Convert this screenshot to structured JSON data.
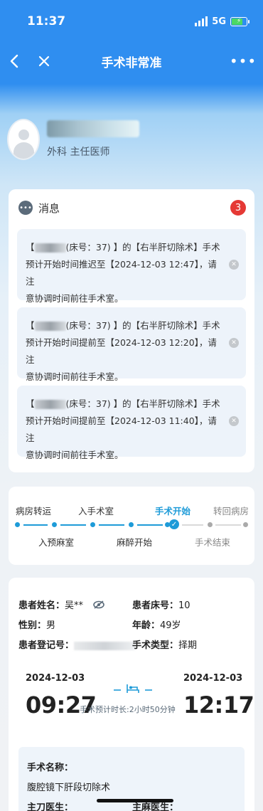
{
  "status_bar": {
    "time": "11:37",
    "network": "5G"
  },
  "nav": {
    "title": "手术非常准",
    "back_icon": "chevron-left-icon",
    "close_icon": "close-icon",
    "more_icon": "more-icon"
  },
  "profile": {
    "department_title": "外科  主任医师"
  },
  "messages": {
    "title": "消息",
    "count": "3",
    "items": [
      {
        "line1_a": "【",
        "line1_b": "(床号：37) 】的【右半肝切除术】手术",
        "line2": "预计开始时间推迟至【2024-12-03 12:47】，请注",
        "line3": "意协调时间前往手术室。"
      },
      {
        "line1_a": "【",
        "line1_b": "(床号：37) 】的【右半肝切除术】手术",
        "line2": "预计开始时间提前至【2024-12-03 12:20】，请注",
        "line3": "意协调时间前往手术室。"
      },
      {
        "line1_a": "【",
        "line1_b": "(床号：37) 】的【右半肝切除术】手术",
        "line2": "预计开始时间提前至【2024-12-03 11:40】，请注",
        "line3": "意协调时间前往手术室。"
      }
    ]
  },
  "flow": {
    "top": [
      "病房转运",
      "入手术室",
      "手术开始",
      "转回病房"
    ],
    "bottom": [
      "入预麻室",
      "麻醉开始",
      "手术结束"
    ],
    "current_step": "手术开始"
  },
  "patient": {
    "name_label": "患者姓名：",
    "name_value": "吴**",
    "bed_label": "患者床号：",
    "bed_value": "10",
    "gender_label": "性别：",
    "gender_value": "男",
    "age_label": "年龄：",
    "age_value": "49岁",
    "reg_label": "患者登记号：",
    "type_label": "手术类型：",
    "type_value": "择期"
  },
  "schedule": {
    "start_date": "2024-12-03",
    "start_time": "09:27",
    "end_date": "2024-12-03",
    "end_time": "12:17",
    "duration": "手术预计时长:2小时50分钟"
  },
  "operation": {
    "name_label": "手术名称：",
    "name_value": "腹腔镜下肝段切除术",
    "surgeon_label": "主刀医生：",
    "anesthetist_label": "主麻医生："
  },
  "colors": {
    "primary": "#2f8ef0",
    "accent": "#1e9bd8",
    "badge": "#e53935"
  }
}
